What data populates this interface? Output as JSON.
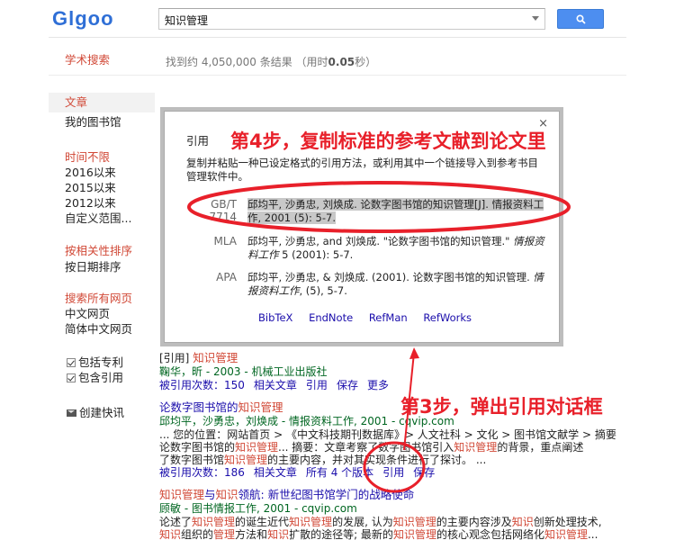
{
  "header": {
    "logo": "Glgoo",
    "search_value": "知识管理"
  },
  "scholar_title": "学术搜索",
  "result_count": {
    "prefix": "找到约 4,050,000 条结果 （用时",
    "time": "0.05",
    "suffix": "秒）"
  },
  "sidebar": {
    "article": "文章",
    "my_library": "我的图书馆",
    "time_any": "时间不限",
    "since_2016": "2016以来",
    "since_2015": "2015以来",
    "since_2012": "2012以来",
    "custom_range": "自定义范围...",
    "sort_relevance": "按相关性排序",
    "sort_date": "按日期排序",
    "search_all": "搜索所有网页",
    "chinese_pages": "中文网页",
    "simplified_pages": "简体中文网页",
    "include_patents": "包括专利",
    "include_citations": "包含引用",
    "create_alert": "创建快讯"
  },
  "dialog": {
    "close": "×",
    "title": "引用",
    "description": "复制并粘贴一种已设定格式的引用方法，或利用其中一个链接导入到参考书目管理软件中。",
    "gb_label": "GB/T 7714",
    "gb_text": "邱均平, 沙勇忠, 刘焕成. 论数字图书馆的知识管理[J]. 情报资料工作, 2001 (5): 5-7.",
    "mla_label": "MLA",
    "mla_text_1": "邱均平, 沙勇忠, and 刘焕成. \"论数字图书馆的知识管理.\" ",
    "mla_journal": "情报资料工作",
    "mla_text_2": " 5 (2001): 5-7.",
    "apa_label": "APA",
    "apa_text_1": "邱均平, 沙勇忠, & 刘焕成. (2001). 论数字图书馆的知识管理. ",
    "apa_journal": "情报资料工作",
    "apa_text_2": ", (5), 5-7.",
    "export_bibtex": "BibTeX",
    "export_endnote": "EndNote",
    "export_refman": "RefMan",
    "export_refworks": "RefWorks"
  },
  "results": [
    {
      "tag": "[引用]",
      "title": "知识管理",
      "authors": "鞠华，昕 - 2003 - 机械工业出版社",
      "cited_by": "被引用次数：150",
      "related": "相关文章",
      "cite": "引用",
      "save": "保存",
      "more": "更多"
    },
    {
      "title_1": "论数字图书馆的",
      "title_2": "知识管理",
      "authors": "邱均平，沙勇忠，刘焕成 - 情报资料工作, 2001 - cqvip.com",
      "snippet_1": "... 您的位置：网站首页 > 《中文科技期刊数据库》> 人文社科 > 文化 > 图书馆文献学 > 摘要",
      "snippet_2a": "论数字图书馆的",
      "snippet_2b": "知识管理",
      "snippet_2c": "... 摘要：文章考察了数字图书馆引入",
      "snippet_2d": "知识管理",
      "snippet_2e": "的背景，重点阐述",
      "snippet_3a": "了数字图书馆",
      "snippet_3b": "知识管理",
      "snippet_3c": "的主要内容，并对其实现条件进行了探讨。 ...",
      "cited_by": "被引用次数：186",
      "related": "相关文章",
      "versions": "所有 4 个版本",
      "cite": "引用",
      "save": "保存"
    },
    {
      "title_a": "知识管理",
      "title_b": "与",
      "title_c": "知识",
      "title_d": "领航: 新世纪图书馆学门的战略使命",
      "authors": "顾敏 - 图书情报工作, 2001 - cqvip.com",
      "snippet_1a": "论述了",
      "snippet_1b": "知识管理",
      "snippet_1c": "的诞生近代",
      "snippet_1d": "知识管理",
      "snippet_1e": "的发展, 认为",
      "snippet_1f": "知识管理",
      "snippet_1g": "的主要内容涉及",
      "snippet_1h": "知识",
      "snippet_1i": "创新处理技术,",
      "snippet_2a": "知识",
      "snippet_2b": "组织的",
      "snippet_2c": "管理",
      "snippet_2d": "方法和",
      "snippet_2e": "知识",
      "snippet_2f": "扩散的途径等; 最新的",
      "snippet_2g": "知识管理",
      "snippet_2h": "的核心观念包括网络化",
      "snippet_2i": "知识管理",
      "snippet_2j": "..."
    }
  ],
  "annotations": {
    "step4": "第4步，复制标准的参考文献到论文里",
    "step3": "第3步，弹出引用对话框"
  },
  "colors": {
    "accent_red": "#e8202a",
    "link_blue": "#1a0dab",
    "green": "#006621",
    "logo_blue": "#2f6fd6"
  }
}
